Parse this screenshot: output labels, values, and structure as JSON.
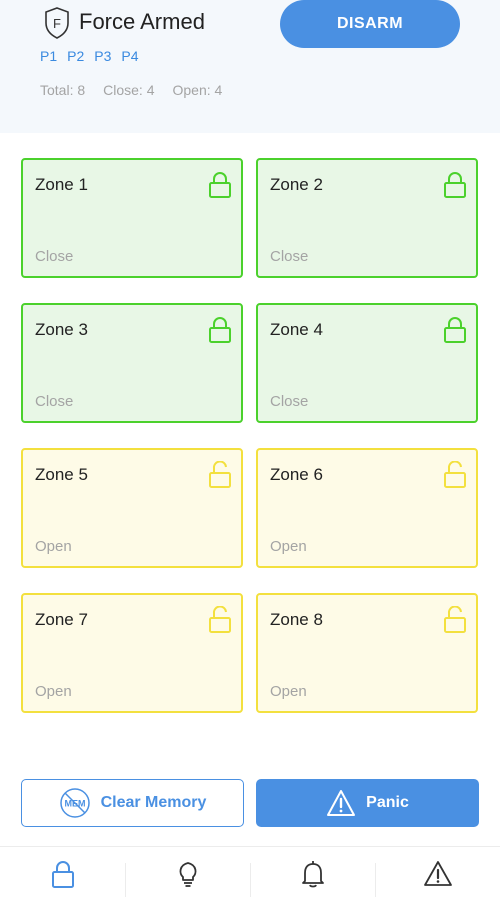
{
  "header": {
    "status_title": "Force Armed",
    "shield_letter": "F",
    "partitions": [
      "P1",
      "P2",
      "P3",
      "P4"
    ],
    "counts": {
      "total": "Total: 8",
      "close": "Close: 4",
      "open": "Open: 4"
    },
    "disarm_label": "DISARM"
  },
  "zones": [
    {
      "name": "Zone 1",
      "state": "Close"
    },
    {
      "name": "Zone 2",
      "state": "Close"
    },
    {
      "name": "Zone 3",
      "state": "Close"
    },
    {
      "name": "Zone 4",
      "state": "Close"
    },
    {
      "name": "Zone 5",
      "state": "Open"
    },
    {
      "name": "Zone 6",
      "state": "Open"
    },
    {
      "name": "Zone 7",
      "state": "Open"
    },
    {
      "name": "Zone 8",
      "state": "Open"
    }
  ],
  "actions": {
    "clear_memory_label": "Clear Memory",
    "mem_icon_text": "MEM",
    "panic_label": "Panic"
  },
  "bottom_nav": [
    {
      "icon": "lock-icon",
      "active": true
    },
    {
      "icon": "bulb-icon",
      "active": false
    },
    {
      "icon": "bell-icon",
      "active": false
    },
    {
      "icon": "warning-icon",
      "active": false
    }
  ],
  "colors": {
    "accent": "#4a90e2",
    "closed_border": "#4bd12c",
    "closed_bg": "#e8f7e6",
    "open_border": "#f3e03e",
    "open_bg": "#fefbe7",
    "muted_text": "#a4a4a4"
  }
}
